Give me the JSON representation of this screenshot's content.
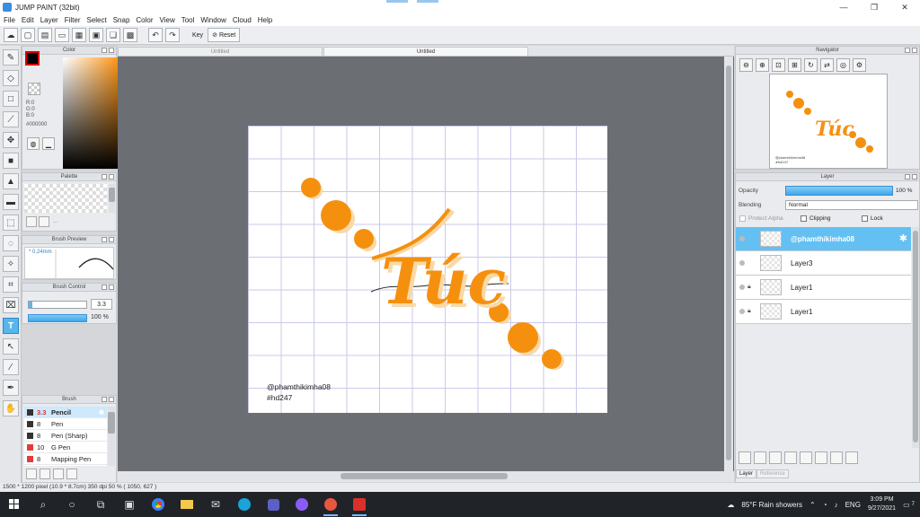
{
  "window": {
    "title": "JUMP PAINT (32bit)",
    "controls": [
      "—",
      "❐",
      "✕"
    ]
  },
  "menu": [
    "File",
    "Edit",
    "Layer",
    "Filter",
    "Select",
    "Snap",
    "Color",
    "View",
    "Tool",
    "Window",
    "Cloud",
    "Help"
  ],
  "toolbar": {
    "key_label": "Key",
    "reset_label": "Reset"
  },
  "tabs": {
    "tab1": "Untitled",
    "tab2": "Untitled"
  },
  "color_panel": {
    "title": "Color",
    "r": "R:0",
    "g": "G:0",
    "b": "B:0",
    "hex": "#000000",
    "foreground": "#000000"
  },
  "palette_panel": {
    "title": "Palette",
    "more": "..."
  },
  "brush_preview": {
    "title": "Brush Preview",
    "size": "* 0.24mm"
  },
  "brush_control": {
    "title": "Brush Control",
    "size_value": "3.3",
    "opacity_value": "100 %"
  },
  "brush_panel": {
    "title": "Brush",
    "items": [
      {
        "size": "3.3",
        "name": "Pencil",
        "color": "#333333",
        "selected": true
      },
      {
        "size": "8",
        "name": "Pen",
        "color": "#333333"
      },
      {
        "size": "8",
        "name": "Pen (Sharp)",
        "color": "#333333"
      },
      {
        "size": "10",
        "name": "G Pen",
        "color": "#e23b3b"
      },
      {
        "size": "8",
        "name": "Mapping Pen",
        "color": "#e23b3b"
      }
    ]
  },
  "canvas": {
    "watermark_line1": "@phamthikimha08",
    "watermark_line2": "#hd247",
    "word": "Túc",
    "accent": "#f5900f"
  },
  "navigator": {
    "title": "Navigator",
    "thumb_line1": "@phamthikimha08",
    "thumb_line2": "#hd247",
    "thumb_word": "Túc"
  },
  "layer_panel": {
    "title": "Layer",
    "opacity_label": "Opacity",
    "opacity_value": "100 %",
    "blending_label": "Blending",
    "blending_value": "Normal",
    "protect_alpha": "Protect Alpha",
    "clipping": "Clipping",
    "lock": "Lock",
    "layers": [
      {
        "name": "@phamthikimha08",
        "selected": true
      },
      {
        "name": "Layer3"
      },
      {
        "name": "Layer1",
        "locked": true
      },
      {
        "name": "Layer1",
        "locked": true
      }
    ],
    "tab_layer": "Layer",
    "tab_reference": "Reference"
  },
  "status": "1500 * 1200 pixel   (10.9 * 8.7cm)  350 dpi   50 %   ( 1050, 627 )",
  "taskbar": {
    "weather": "85°F  Rain showers",
    "lang": "ENG",
    "time": "3:09 PM",
    "date": "9/27/2021",
    "notifications": "7"
  }
}
